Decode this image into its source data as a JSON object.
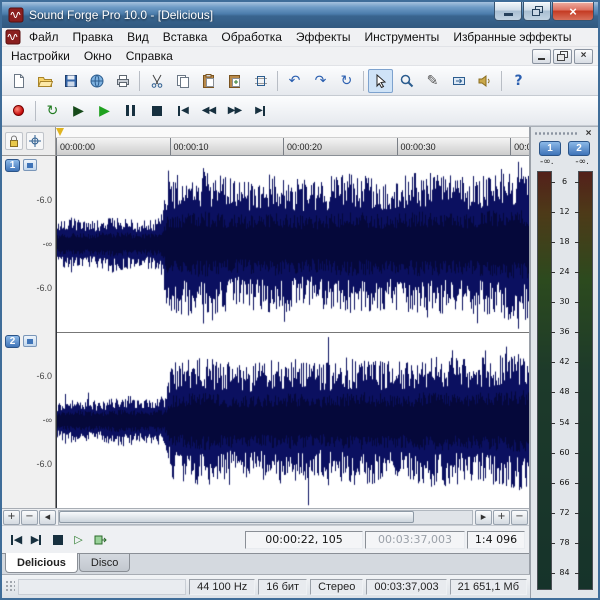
{
  "window": {
    "title": "Sound Forge Pro 10.0 - [Delicious]"
  },
  "menus": {
    "row1": [
      "Файл",
      "Правка",
      "Вид",
      "Вставка",
      "Обработка",
      "Эффекты",
      "Инструменты",
      "Избранные эффекты"
    ],
    "row2": [
      "Настройки",
      "Окно",
      "Справка"
    ]
  },
  "toolbar": {
    "buttons": [
      "new-file",
      "open-file",
      "save-file",
      "publish",
      "print",
      "|",
      "cut",
      "copy",
      "paste",
      "mix-paste",
      "trim",
      "|",
      "undo",
      "redo",
      "repeat",
      "|",
      "edit-tool",
      "magnify-tool",
      "pencil-tool",
      "event-tool",
      "scrub-tool",
      "|",
      "whats-this-help"
    ],
    "selected": "edit-tool"
  },
  "transport": {
    "buttons": [
      "record",
      "|",
      "loop-playback",
      "play-all",
      "play",
      "pause",
      "stop",
      "go-to-start",
      "rewind",
      "fast-forward",
      "go-to-end"
    ]
  },
  "ruler": {
    "ticks": [
      {
        "label": "00:00:00",
        "pos": 0
      },
      {
        "label": "00:00:10",
        "pos": 0.24
      },
      {
        "label": "00:00:20",
        "pos": 0.48
      },
      {
        "label": "00:00:30",
        "pos": 0.72
      },
      {
        "label": "00:00",
        "pos": 0.96
      }
    ]
  },
  "channels": [
    {
      "number": "1",
      "db_labels": [
        "-6.0",
        "-∞",
        "-6.0"
      ]
    },
    {
      "number": "2",
      "db_labels": [
        "-6.0",
        "-∞",
        "-6.0"
      ]
    }
  ],
  "waveform": {
    "color": "#0b1060",
    "core_color": "#05083a",
    "center_line_color": "#8a8a8a",
    "seed1": 20,
    "seed2": 77,
    "envelope1": [
      [
        0,
        0.24
      ],
      [
        0.03,
        0.3
      ],
      [
        0.07,
        0.26
      ],
      [
        0.12,
        0.33
      ],
      [
        0.17,
        0.27
      ],
      [
        0.22,
        0.31
      ],
      [
        0.235,
        0.78
      ],
      [
        0.3,
        0.84
      ],
      [
        0.38,
        0.74
      ],
      [
        0.46,
        0.8
      ],
      [
        0.54,
        0.72
      ],
      [
        0.62,
        0.82
      ],
      [
        0.7,
        0.75
      ],
      [
        0.78,
        0.84
      ],
      [
        0.86,
        0.77
      ],
      [
        0.93,
        0.86
      ],
      [
        1,
        0.88
      ]
    ],
    "envelope2": [
      [
        0,
        0.2
      ],
      [
        0.04,
        0.27
      ],
      [
        0.09,
        0.23
      ],
      [
        0.14,
        0.3
      ],
      [
        0.19,
        0.25
      ],
      [
        0.23,
        0.29
      ],
      [
        0.245,
        0.66
      ],
      [
        0.31,
        0.74
      ],
      [
        0.4,
        0.64
      ],
      [
        0.48,
        0.72
      ],
      [
        0.56,
        0.65
      ],
      [
        0.64,
        0.74
      ],
      [
        0.72,
        0.67
      ],
      [
        0.8,
        0.76
      ],
      [
        0.88,
        0.7
      ],
      [
        0.95,
        0.78
      ],
      [
        1,
        0.8
      ]
    ]
  },
  "scrollbar": {
    "plus": "+",
    "minus": "−"
  },
  "playbar": {
    "buttons": [
      "go-to-start",
      "go-to-end",
      "stop",
      "play-normal",
      "open-remote"
    ],
    "position": "00:00:22, 105",
    "length": "00:03:37,003",
    "zoom_ratio": "1:4 096"
  },
  "meters": {
    "channel_buttons": [
      "1",
      "2"
    ],
    "peak_values": [
      "-∞.",
      "-∞."
    ],
    "scale": [
      "6",
      "12",
      "18",
      "24",
      "30",
      "36",
      "42",
      "48",
      "54",
      "60",
      "66",
      "72",
      "78",
      "84"
    ]
  },
  "tabs": [
    {
      "label": "Delicious",
      "active": true
    },
    {
      "label": "Disco",
      "active": false
    }
  ],
  "statusbar": {
    "cells": [
      "44 100 Hz",
      "16 бит",
      "Стерео",
      "00:03:37,003",
      "21 651,1 Мб"
    ]
  }
}
